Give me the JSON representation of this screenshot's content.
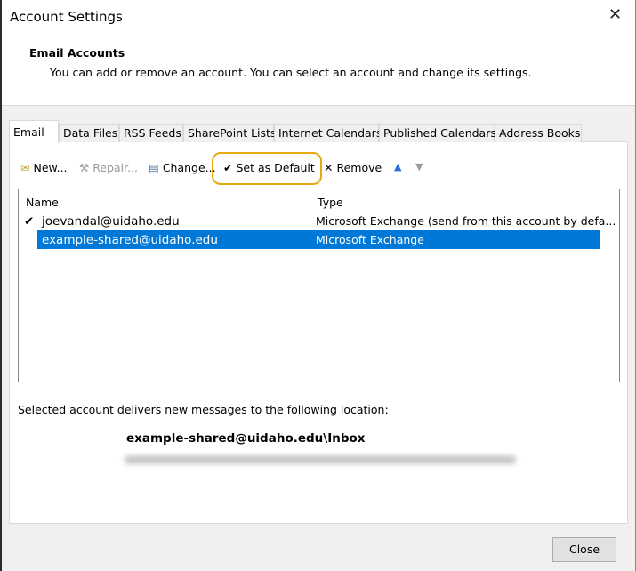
{
  "window": {
    "title": "Account Settings"
  },
  "header": {
    "title": "Email Accounts",
    "subtitle": "You can add or remove an account. You can select an account and change its settings."
  },
  "tabs": [
    {
      "label": "Email",
      "active": true
    },
    {
      "label": "Data Files"
    },
    {
      "label": "RSS Feeds"
    },
    {
      "label": "SharePoint Lists"
    },
    {
      "label": "Internet Calendars"
    },
    {
      "label": "Published Calendars"
    },
    {
      "label": "Address Books"
    }
  ],
  "toolbar": {
    "new": "New...",
    "repair": "Repair...",
    "change": "Change...",
    "set_default": "Set as Default",
    "remove": "Remove"
  },
  "list": {
    "columns": [
      "Name",
      "Type"
    ],
    "rows": [
      {
        "name": "joevandal@uidaho.edu",
        "type": "Microsoft Exchange (send from this account by defa...",
        "default": true
      },
      {
        "name": "example-shared@uidaho.edu",
        "type": "Microsoft Exchange",
        "selected": true
      }
    ]
  },
  "delivery": {
    "label": "Selected account delivers new messages to the following location:",
    "location": "example-shared@uidaho.edu\\Inbox"
  },
  "footer": {
    "close": "Close"
  },
  "colors": {
    "selection": "#0078d7",
    "highlight": "#e8a812"
  }
}
